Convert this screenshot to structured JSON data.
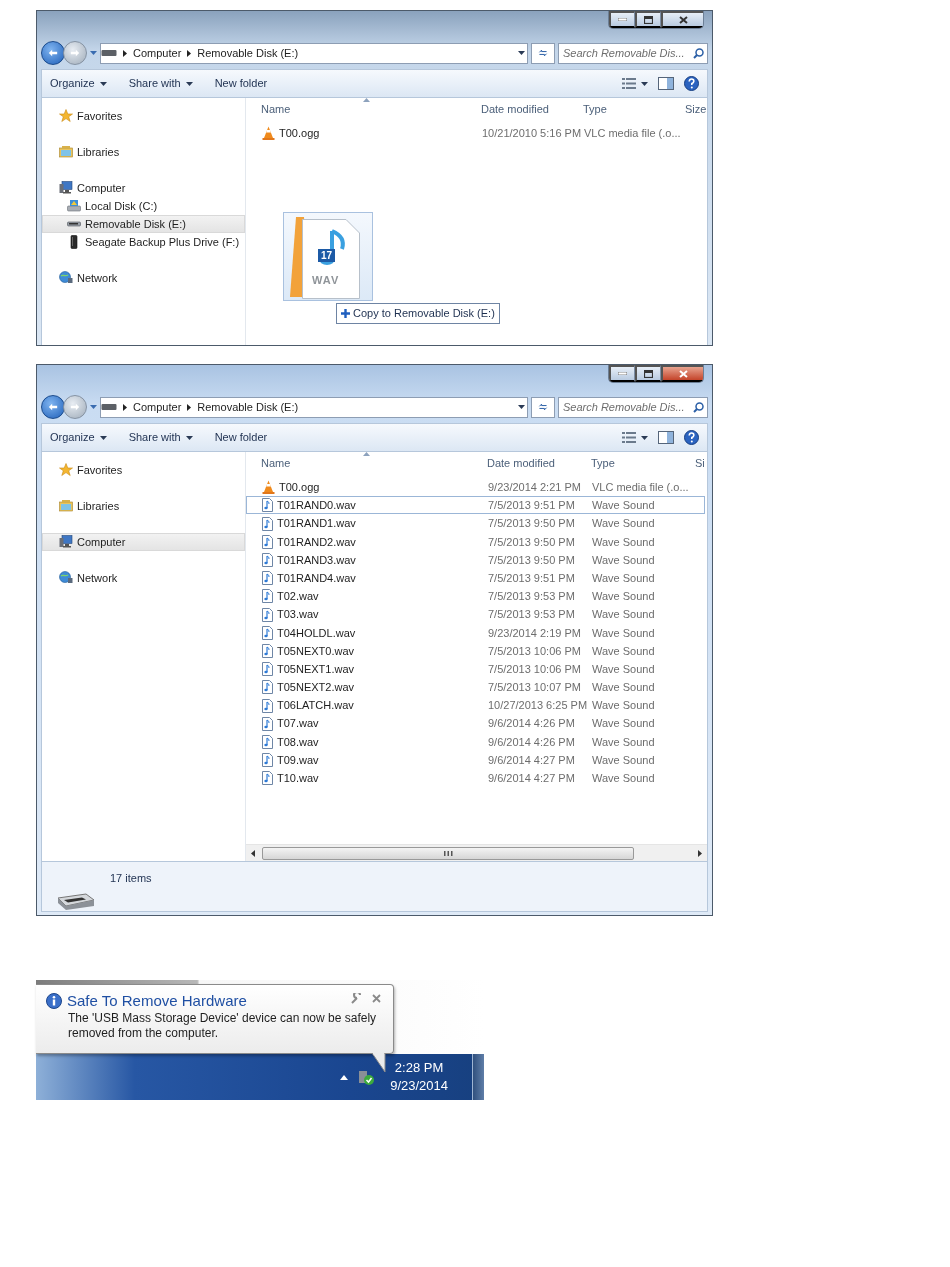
{
  "windows": [
    {
      "active": false,
      "breadcrumb": [
        "Computer",
        "Removable Disk (E:)"
      ],
      "search": {
        "placeholder": "Search Removable Dis..."
      },
      "toolbar": [
        {
          "label": "Organize",
          "dropdown": true
        },
        {
          "label": "Share with",
          "dropdown": true
        },
        {
          "label": "New folder",
          "dropdown": false
        }
      ],
      "nav": [
        {
          "label": "Favorites",
          "kind": "star",
          "selected": false
        },
        {
          "label": "Libraries",
          "kind": "library",
          "selected": false
        },
        {
          "label": "Computer",
          "kind": "computer",
          "selected": false,
          "children": [
            {
              "label": "Local Disk (C:)",
              "kind": "disk",
              "selected": false
            },
            {
              "label": "Removable Disk (E:)",
              "kind": "removable",
              "selected": true
            },
            {
              "label": "Seagate Backup Plus Drive (F:)",
              "kind": "drive",
              "selected": false
            }
          ]
        },
        {
          "label": "Network",
          "kind": "network",
          "selected": false
        }
      ],
      "columns": [
        "Name",
        "Date modified",
        "Type",
        "Size"
      ],
      "files": [
        {
          "name": "T00.ogg",
          "kind": "vlc",
          "date": "10/21/2010 5:16 PM",
          "type": "VLC media file (.o...",
          "selected": false
        }
      ],
      "drag": {
        "badge": "17",
        "ext": "WAV",
        "label": "Copy to Removable Disk (E:)"
      }
    },
    {
      "active": true,
      "breadcrumb": [
        "Computer",
        "Removable Disk (E:)"
      ],
      "search": {
        "placeholder": "Search Removable Dis..."
      },
      "toolbar": [
        {
          "label": "Organize",
          "dropdown": true
        },
        {
          "label": "Share with",
          "dropdown": true
        },
        {
          "label": "New folder",
          "dropdown": false
        }
      ],
      "nav": [
        {
          "label": "Favorites",
          "kind": "star",
          "selected": false
        },
        {
          "label": "Libraries",
          "kind": "library",
          "selected": false
        },
        {
          "label": "Computer",
          "kind": "computer",
          "selected": true
        },
        {
          "label": "Network",
          "kind": "network",
          "selected": false
        }
      ],
      "columns": [
        "Name",
        "Date modified",
        "Type",
        "Si"
      ],
      "files": [
        {
          "name": "T00.ogg",
          "kind": "vlc",
          "date": "9/23/2014 2:21 PM",
          "type": "VLC media file (.o...",
          "selected": false
        },
        {
          "name": "T01RAND0.wav",
          "kind": "wav",
          "date": "7/5/2013 9:51 PM",
          "type": "Wave Sound",
          "selected": true
        },
        {
          "name": "T01RAND1.wav",
          "kind": "wav",
          "date": "7/5/2013 9:50 PM",
          "type": "Wave Sound",
          "selected": false
        },
        {
          "name": "T01RAND2.wav",
          "kind": "wav",
          "date": "7/5/2013 9:50 PM",
          "type": "Wave Sound",
          "selected": false
        },
        {
          "name": "T01RAND3.wav",
          "kind": "wav",
          "date": "7/5/2013 9:50 PM",
          "type": "Wave Sound",
          "selected": false
        },
        {
          "name": "T01RAND4.wav",
          "kind": "wav",
          "date": "7/5/2013 9:51 PM",
          "type": "Wave Sound",
          "selected": false
        },
        {
          "name": "T02.wav",
          "kind": "wav",
          "date": "7/5/2013 9:53 PM",
          "type": "Wave Sound",
          "selected": false
        },
        {
          "name": "T03.wav",
          "kind": "wav",
          "date": "7/5/2013 9:53 PM",
          "type": "Wave Sound",
          "selected": false
        },
        {
          "name": "T04HOLDL.wav",
          "kind": "wav",
          "date": "9/23/2014 2:19 PM",
          "type": "Wave Sound",
          "selected": false
        },
        {
          "name": "T05NEXT0.wav",
          "kind": "wav",
          "date": "7/5/2013 10:06 PM",
          "type": "Wave Sound",
          "selected": false
        },
        {
          "name": "T05NEXT1.wav",
          "kind": "wav",
          "date": "7/5/2013 10:06 PM",
          "type": "Wave Sound",
          "selected": false
        },
        {
          "name": "T05NEXT2.wav",
          "kind": "wav",
          "date": "7/5/2013 10:07 PM",
          "type": "Wave Sound",
          "selected": false
        },
        {
          "name": "T06LATCH.wav",
          "kind": "wav",
          "date": "10/27/2013 6:25 PM",
          "type": "Wave Sound",
          "selected": false
        },
        {
          "name": "T07.wav",
          "kind": "wav",
          "date": "9/6/2014 4:26 PM",
          "type": "Wave Sound",
          "selected": false
        },
        {
          "name": "T08.wav",
          "kind": "wav",
          "date": "9/6/2014 4:26 PM",
          "type": "Wave Sound",
          "selected": false
        },
        {
          "name": "T09.wav",
          "kind": "wav",
          "date": "9/6/2014 4:27 PM",
          "type": "Wave Sound",
          "selected": false
        },
        {
          "name": "T10.wav",
          "kind": "wav",
          "date": "9/6/2014 4:27 PM",
          "type": "Wave Sound",
          "selected": false
        }
      ],
      "status": "17 items"
    }
  ],
  "notification": {
    "title": "Safe To Remove Hardware",
    "message": "The 'USB Mass Storage Device' device can now be safely removed from the computer."
  },
  "clock": {
    "time": "2:28 PM",
    "date": "9/23/2014"
  }
}
